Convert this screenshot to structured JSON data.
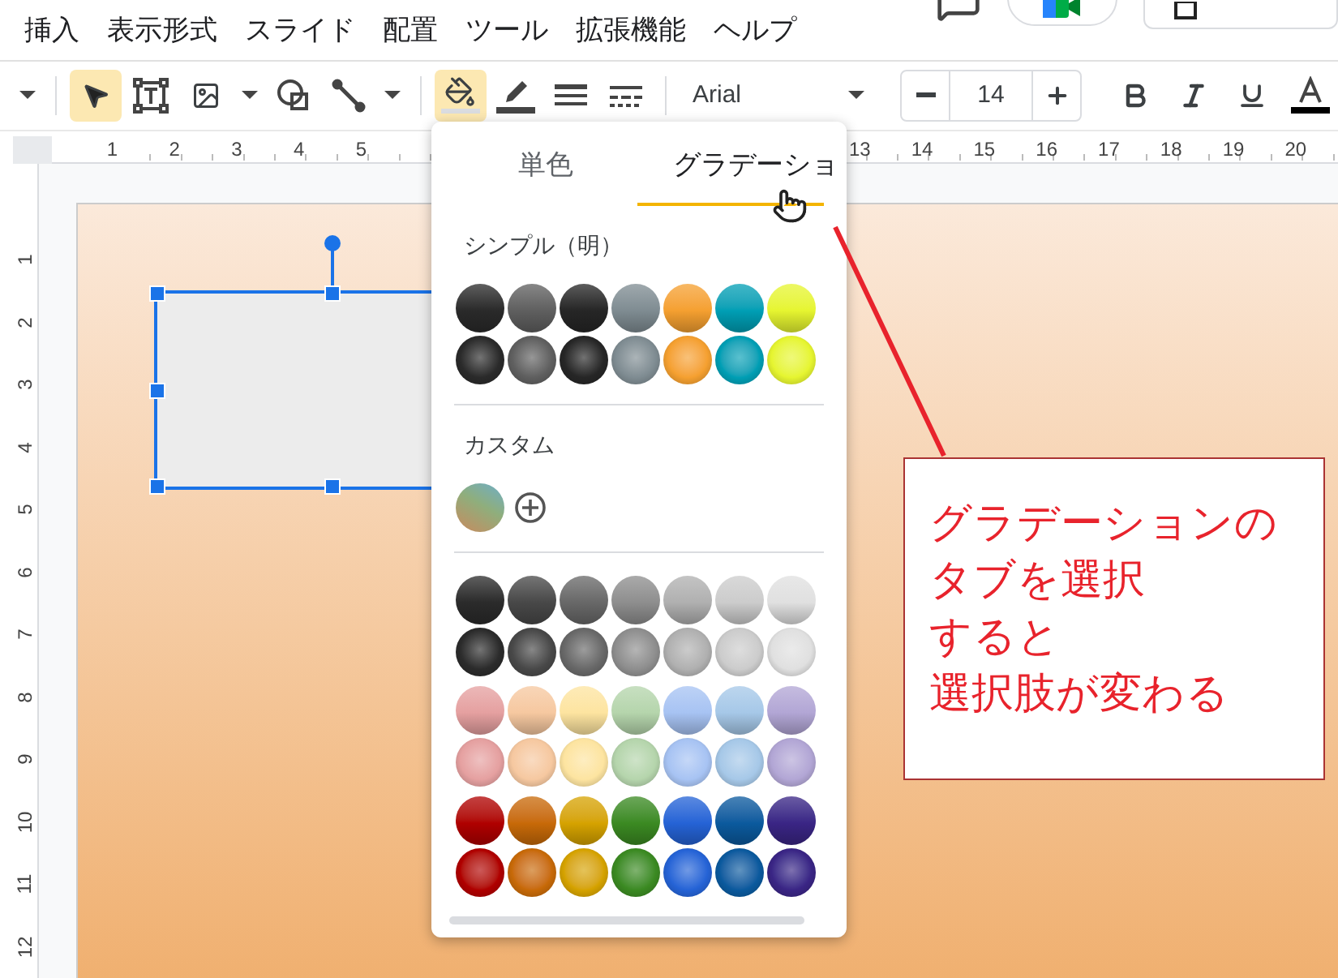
{
  "menu": {
    "items": [
      "挿入",
      "表示形式",
      "スライド",
      "配置",
      "ツール",
      "拡張機能",
      "ヘルプ"
    ]
  },
  "toolbar": {
    "groups": [
      [
        {
          "kind": "more",
          "selected": false
        }
      ],
      [
        {
          "kind": "select",
          "selected": true
        },
        {
          "kind": "textbox",
          "selected": false
        },
        {
          "kind": "image",
          "selected": false
        },
        {
          "kind": "caret",
          "selected": false
        },
        {
          "kind": "shape",
          "selected": false
        },
        {
          "kind": "line",
          "selected": false
        },
        {
          "kind": "caret",
          "selected": false
        }
      ],
      [
        {
          "kind": "fill",
          "selected": true
        },
        {
          "kind": "border-color",
          "selected": false
        },
        {
          "kind": "border-weight",
          "selected": false
        },
        {
          "kind": "border-dash",
          "selected": false
        }
      ],
      [
        {
          "kind": "font",
          "value": "Arial"
        },
        {
          "kind": "size",
          "value": "14"
        },
        {
          "kind": "bold",
          "selected": false
        },
        {
          "kind": "italic",
          "selected": false
        },
        {
          "kind": "underline",
          "selected": false
        },
        {
          "kind": "text-color",
          "selected": false
        }
      ]
    ]
  },
  "horizontal_ruler": {
    "segments": [
      [
        "1",
        "2",
        "3",
        "4",
        "5"
      ],
      [
        "13",
        "14",
        "15",
        "16",
        "17",
        "18",
        "19",
        "20"
      ]
    ]
  },
  "vertical_ruler": {
    "labels": [
      "1",
      "2",
      "3",
      "4",
      "5",
      "6",
      "7",
      "8",
      "9",
      "10",
      "11",
      "12"
    ]
  },
  "popup": {
    "tabs": [
      {
        "label": "単色",
        "selected": false
      },
      {
        "label": "グラデーショ",
        "selected": true
      }
    ],
    "sections": [
      {
        "kind": "preset",
        "title": "シンプル（明）",
        "rows": [
          {
            "kind": "linear",
            "swatches": [
              {
                "color": "#2a2a2a"
              },
              {
                "color": "#5f5f5f"
              },
              {
                "color": "#262626"
              },
              {
                "color": "#7f8c92"
              },
              {
                "color": "#f5a030"
              },
              {
                "color": "#009fb5"
              },
              {
                "color": "#e6f530"
              }
            ]
          },
          {
            "kind": "radial",
            "swatches": [
              {
                "color": "#2a2a2a"
              },
              {
                "color": "#5f5f5f"
              },
              {
                "color": "#262626"
              },
              {
                "color": "#7f8c92"
              },
              {
                "color": "#f5a030"
              },
              {
                "color": "#009fb5"
              },
              {
                "color": "#e6f530"
              }
            ]
          }
        ]
      },
      {
        "kind": "custom",
        "title": "カスタム",
        "swatches": [
          {
            "color": "#8fae7c"
          }
        ]
      },
      {
        "kind": "preset",
        "rows": [
          {
            "kind": "linear",
            "swatches": [
              {
                "color": "#2b2b2b"
              },
              {
                "color": "#484848"
              },
              {
                "color": "#686868"
              },
              {
                "color": "#8e8e8e"
              },
              {
                "color": "#b0b0b0"
              },
              {
                "color": "#cccccc"
              },
              {
                "color": "#e0e0e0"
              }
            ]
          },
          {
            "kind": "radial",
            "swatches": [
              {
                "color": "#2b2b2b"
              },
              {
                "color": "#484848"
              },
              {
                "color": "#686868"
              },
              {
                "color": "#8e8e8e"
              },
              {
                "color": "#b0b0b0"
              },
              {
                "color": "#cccccc"
              },
              {
                "color": "#e0e0e0"
              }
            ]
          },
          {
            "kind": "linear",
            "swatches": [
              {
                "color": "#e5a0a0"
              },
              {
                "color": "#f6c8a0"
              },
              {
                "color": "#fde4a0"
              },
              {
                "color": "#b5d5ac"
              },
              {
                "color": "#a7c3f3"
              },
              {
                "color": "#a6c8e8"
              },
              {
                "color": "#b2a6d5"
              }
            ]
          },
          {
            "kind": "radial",
            "swatches": [
              {
                "color": "#e5a0a0"
              },
              {
                "color": "#f6c8a0"
              },
              {
                "color": "#fde4a0"
              },
              {
                "color": "#b5d5ac"
              },
              {
                "color": "#a7c3f3"
              },
              {
                "color": "#a6c8e8"
              },
              {
                "color": "#b2a6d5"
              }
            ]
          },
          {
            "kind": "linear",
            "swatches": [
              {
                "color": "#b00000"
              },
              {
                "color": "#c86a08"
              },
              {
                "color": "#d6a300"
              },
              {
                "color": "#3b8a22"
              },
              {
                "color": "#2563d6"
              },
              {
                "color": "#0b5a9e"
              },
              {
                "color": "#3a2585"
              }
            ]
          },
          {
            "kind": "radial",
            "swatches": [
              {
                "color": "#b00000"
              },
              {
                "color": "#c86a08"
              },
              {
                "color": "#d6a300"
              },
              {
                "color": "#3b8a22"
              },
              {
                "color": "#2563d6"
              },
              {
                "color": "#0b5a9e"
              },
              {
                "color": "#3a2585"
              }
            ]
          }
        ]
      }
    ]
  },
  "callout": {
    "lines": [
      "グラデーションの",
      "タブを選択",
      "すると",
      "選択肢が変わる"
    ]
  }
}
